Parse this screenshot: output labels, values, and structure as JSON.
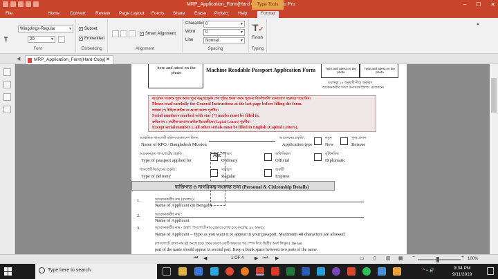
{
  "window": {
    "title": "MRP_Application_Form[Hard Copy].pdf - Nitro Pro",
    "context_tab": "Type Tools",
    "min": "–",
    "max": "☐",
    "close": "✕"
  },
  "ribbon_tabs": [
    "File",
    "Home",
    "Convert",
    "Review",
    "Page Layout",
    "Forms",
    "Share",
    "Erase",
    "Protect",
    "Help",
    "Format"
  ],
  "ribbon": {
    "font_name": "Wingdings-Regular",
    "font_size": "20",
    "subset_label": "Subset",
    "embedded_label": "Embedded",
    "smart_alignment_label": "Smart Alignment",
    "character_label": "Character",
    "character_value": "0",
    "word_label": "Word",
    "word_value": "0",
    "line_label": "Line",
    "line_value": "Normal",
    "finish_label": "Finish",
    "groups": {
      "font": "Font",
      "embedding": "Embedding",
      "alignment": "Alignment",
      "spacing": "Spacing",
      "typing": "Typing"
    }
  },
  "doc_tab": {
    "label": "MRP_Application_Form[Hard Copy]",
    "close": "✕"
  },
  "page": {
    "photo_left_text": "here and attest on the photo",
    "form_title": "Machine Readable Passport Application Form",
    "photo_right1": "here and attest on the photo",
    "photo_right2": "here and attest on the photo",
    "bn_note_right": "তথ্যসমূহ ১৪ অনুযায়ী নীচে অনুসরণ",
    "bn_note_right2": "আবেদনকারীর সংখ্যা উপাত্তকে হবিশ্যৎ প্রয়োজনে।",
    "notice": {
      "bn1": "আবেদন সংক্রান্ত পূরণ করার পূর্বে অনুগ্রহপূর্বক শেষ পৃষ্ঠার প্রদত্ত ‘ফরম পূরণের নির্দেশাবলি’ মনোযোগ সহকারে পড়ে নিন।",
      "en1": "Please read carefully the General Instructions at  the last page before filling the form.",
      "bn2": "তারকা (*) চিহ্নিত ক্রমিক নং গুলো অবশ্য পূরণীয়।",
      "en2": "Serial numbers marked with star (*) marks must be filled in.",
      "bn3": "ক্রমিক নং ১ ব্যতীত অন্যান্য ক্রমিক ইংরেজীতে (Capital Letters) পূরণীয়।",
      "en3": "Except serial number 1, all other serials must be filled in English  (Capital Letters)."
    },
    "rpo_bn": "আঞ্চলিক পাসপোর্ট অফিস/বাংলাদেশ মিশন :",
    "rpo_en": "Name of RPO / Bangladesh Mission",
    "app_type_bn": "আবেদনের প্রকৃতি :",
    "app_type_en": "Application type",
    "new_bn": "নতুন",
    "new_en": "New",
    "reissue_bn": "পুনঃ প্রদান",
    "reissue_en": "Reissue",
    "ptype_bn": "আবেদনকৃত পাসপোর্টের প্রকৃতি :",
    "ptype_en": "Type of passport applied for",
    "ordinary_bn": "সাধারণ",
    "ordinary_en": "Ordinary",
    "official_bn": "অফিসিয়াল",
    "official_en": "Official",
    "diplomatic_bn": "কূটনৈতিক",
    "diplomatic_en": "Diplomatic",
    "delivery_bn": "পাসপোর্ট বিতরণের প্রকৃতি :",
    "delivery_en": "Type of delivery",
    "regular_bn": "সাধারণ",
    "regular_en": "Regular",
    "express_bn": "জরুরী",
    "express_en": "Express",
    "cursor_text": "Abc",
    "section_title": "ব্যক্তিগত ও নাগরিকত্ব সংক্রান্ত তথ্য (Personal & Citizenship Details)",
    "n1": "1.",
    "n1_bn": "আবেদনকারীর নাম (বাংলায়) :",
    "n1_en": "Name of Applicant (in Bengali)",
    "n2": "2.",
    "n2_bn": "আবেদনকারীর নাম :",
    "n2_en": "Name of Applicant",
    "n3": "3.",
    "n3_bn": "আবেদনকারীর নাম - অর্থাৎ পাসপোর্টে নাম যেভাবে লেখা হবে (সর্বোচ্চ ৪৮ অক্ষর) :",
    "n3_en": "Name of Applicant – Type as you want it to appear in your passport. Maximum 48 characters are   allowed.",
    "n3_bn2": "(পাসপোর্টে লেখা নাম দুই অংশে হবে। প্রথম অংশে একটি অক্ষরের পর স্পেস দিয়ে দ্বিতীয় অংশ লিখুন।)  The last",
    "n3_en2": "part of the name should appear in second part. Keep a blank space between two parts of the name."
  },
  "status": {
    "page": "1 OF 4",
    "zoom": "100%"
  },
  "taskbar": {
    "search_placeholder": "Type here to search",
    "time": "9:34 PM",
    "date": "9/11/2019",
    "tray_text": "^ ⌁ 🔊"
  }
}
